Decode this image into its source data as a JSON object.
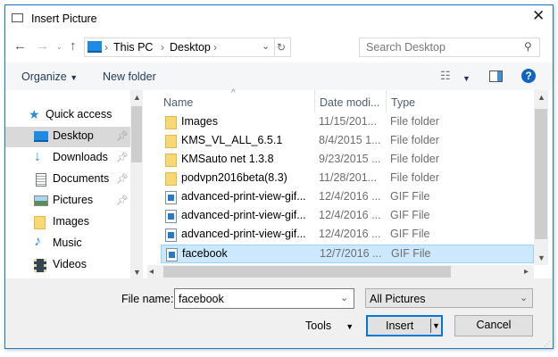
{
  "title": "Insert Picture",
  "nav": {
    "breadcrumb": [
      "This PC",
      "Desktop"
    ],
    "search_placeholder": "Search Desktop"
  },
  "toolbar": {
    "organize": "Organize",
    "new_folder": "New folder"
  },
  "sidebar": {
    "items": [
      {
        "label": "Quick access",
        "icon": "star-icon"
      },
      {
        "label": "Desktop",
        "icon": "desktop-icon",
        "pinned": true,
        "selected": true
      },
      {
        "label": "Downloads",
        "icon": "download-icon",
        "pinned": true
      },
      {
        "label": "Documents",
        "icon": "document-icon",
        "pinned": true
      },
      {
        "label": "Pictures",
        "icon": "pictures-icon",
        "pinned": true
      },
      {
        "label": "Images",
        "icon": "folder-icon"
      },
      {
        "label": "Music",
        "icon": "music-icon"
      },
      {
        "label": "Videos",
        "icon": "video-icon"
      }
    ]
  },
  "columns": [
    "Name",
    "Date modi...",
    "Type"
  ],
  "files": [
    {
      "name": "Images",
      "date": "11/15/201...",
      "type": "File folder",
      "kind": "folder"
    },
    {
      "name": "KMS_VL_ALL_6.5.1",
      "date": "8/4/2015 1...",
      "type": "File folder",
      "kind": "folder"
    },
    {
      "name": "KMSauto net 1.3.8",
      "date": "9/23/2015 ...",
      "type": "File folder",
      "kind": "folder"
    },
    {
      "name": "podvpn2016beta(8.3)",
      "date": "11/28/201...",
      "type": "File folder",
      "kind": "folder"
    },
    {
      "name": "advanced-print-view-gif...",
      "date": "12/4/2016 ...",
      "type": "GIF File",
      "kind": "gif"
    },
    {
      "name": "advanced-print-view-gif...",
      "date": "12/4/2016 ...",
      "type": "GIF File",
      "kind": "gif"
    },
    {
      "name": "advanced-print-view-gif...",
      "date": "12/4/2016 ...",
      "type": "GIF File",
      "kind": "gif"
    },
    {
      "name": "facebook",
      "date": "12/7/2016 ...",
      "type": "GIF File",
      "kind": "gif",
      "selected": true
    }
  ],
  "bottom": {
    "file_name_label": "File name:",
    "file_name_value": "facebook",
    "filter": "All Pictures",
    "tools": "Tools",
    "insert": "Insert",
    "cancel": "Cancel"
  },
  "colors": {
    "accent": "#0078d7",
    "selection": "#cce8ff"
  }
}
